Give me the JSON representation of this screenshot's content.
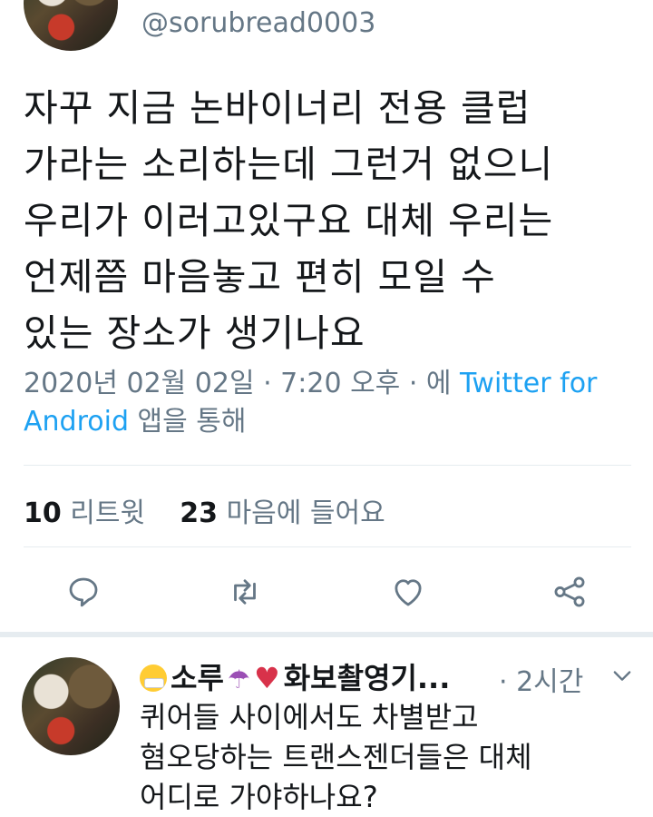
{
  "tweet": {
    "handle": "@sorubread0003",
    "text": "자꾸 지금 논바이너리 전용 클럽\n가라는 소리하는데 그런거 없으니\n우리가 이러고있구요 대체 우리는\n언제쯤 마음놓고 편히 모일 수\n있는 장소가 생기나요",
    "timestamp": "2020년 02월 02일 · 7:20 오후 · 에",
    "via_link": "Twitter for Android",
    "via_suffix": "앱을 통해",
    "retweet_count": "10",
    "retweet_label": "리트윗",
    "like_count": "23",
    "like_label": "마음에 들어요"
  },
  "actions": {
    "reply": "reply-icon",
    "retweet": "retweet-icon",
    "like": "heart-icon",
    "share": "share-icon"
  },
  "reply": {
    "name": "소루",
    "name_rest": "화보촬영기...",
    "time": "· 2시간",
    "text": "퀴어들 사이에서도 차별받고\n혐오당하는 트랜스젠더들은 대체\n어디로 가야하나요?"
  },
  "colors": {
    "link": "#1da1f2",
    "secondary": "#657786",
    "divider": "#e6ecf0"
  }
}
